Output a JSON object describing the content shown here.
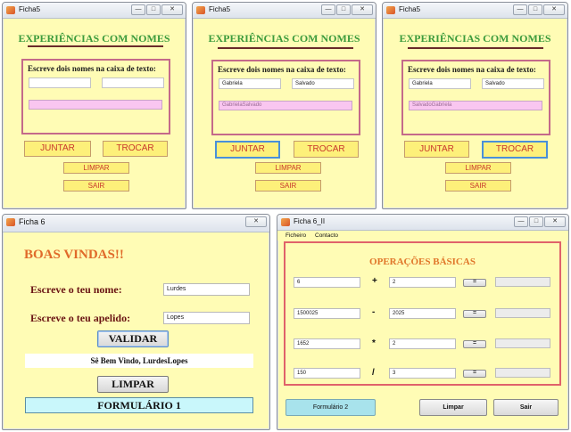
{
  "windows": {
    "ficha5_a": {
      "title": "Ficha5",
      "heading": "EXPERIÊNCIAS COM NOMES",
      "prompt": "Escreve dois nomes na caixa de texto:",
      "name1": "",
      "name2": "",
      "result": "",
      "buttons": {
        "juntar": "JUNTAR",
        "trocar": "TROCAR",
        "limpar": "LIMPAR",
        "sair": "SAIR"
      }
    },
    "ficha5_b": {
      "title": "Ficha5",
      "heading": "EXPERIÊNCIAS COM NOMES",
      "prompt": "Escreve dois nomes na caixa de texto:",
      "name1": "Gabriela",
      "name2": "Salvado",
      "result": "GabrielaSalvado",
      "buttons": {
        "juntar": "JUNTAR",
        "trocar": "TROCAR",
        "limpar": "LIMPAR",
        "sair": "SAIR"
      }
    },
    "ficha5_c": {
      "title": "Ficha5",
      "heading": "EXPERIÊNCIAS COM NOMES",
      "prompt": "Escreve dois nomes na caixa de texto:",
      "name1": "Gabriela",
      "name2": "Salvado",
      "result": "SalvadoGabriela",
      "buttons": {
        "juntar": "JUNTAR",
        "trocar": "TROCAR",
        "limpar": "LIMPAR",
        "sair": "SAIR"
      }
    },
    "ficha6": {
      "title": "Ficha 6",
      "greeting_title": "BOAS VINDAS!!",
      "name_label": "Escreve o teu nome:",
      "name_value": "Lurdes",
      "surname_label": "Escreve o teu apelido:",
      "surname_value": "Lopes",
      "validar": "VALIDAR",
      "welcome_message": "Sê Bem Vindo, LurdesLopes",
      "limpar": "LIMPAR",
      "formulario": "FORMULÁRIO 1"
    },
    "ficha6_ii": {
      "title": "Ficha 6_II",
      "menu": [
        "Ficheiro",
        "Contacto"
      ],
      "heading": "OPERAÇÕES BÁSICAS",
      "rows": [
        {
          "a": "6",
          "op": "+",
          "b": "2",
          "button": "=",
          "result": ""
        },
        {
          "a": "1500025",
          "op": "-",
          "b": "2025",
          "button": "=",
          "result": ""
        },
        {
          "a": "1652",
          "op": "*",
          "b": "2",
          "button": "=",
          "result": ""
        },
        {
          "a": "150",
          "op": "/",
          "b": "3",
          "button": "=",
          "result": ""
        }
      ],
      "formulario2": "Formulário 2",
      "limpar": "Limpar",
      "sair": "Sair"
    }
  },
  "window_controls": {
    "minimize": "—",
    "maximize": "□",
    "close": "✕"
  },
  "colors": {
    "window_bg": "#fffcb5",
    "heading_green": "#3c9b3c",
    "button_yellow": "#fdf07a",
    "button_text_red": "#c8382d",
    "result_pink": "#f9c6f0",
    "focus_blue": "#4a90d9",
    "heading_orange": "#e0762a",
    "formulario_cyan": "#c9f7fb"
  }
}
